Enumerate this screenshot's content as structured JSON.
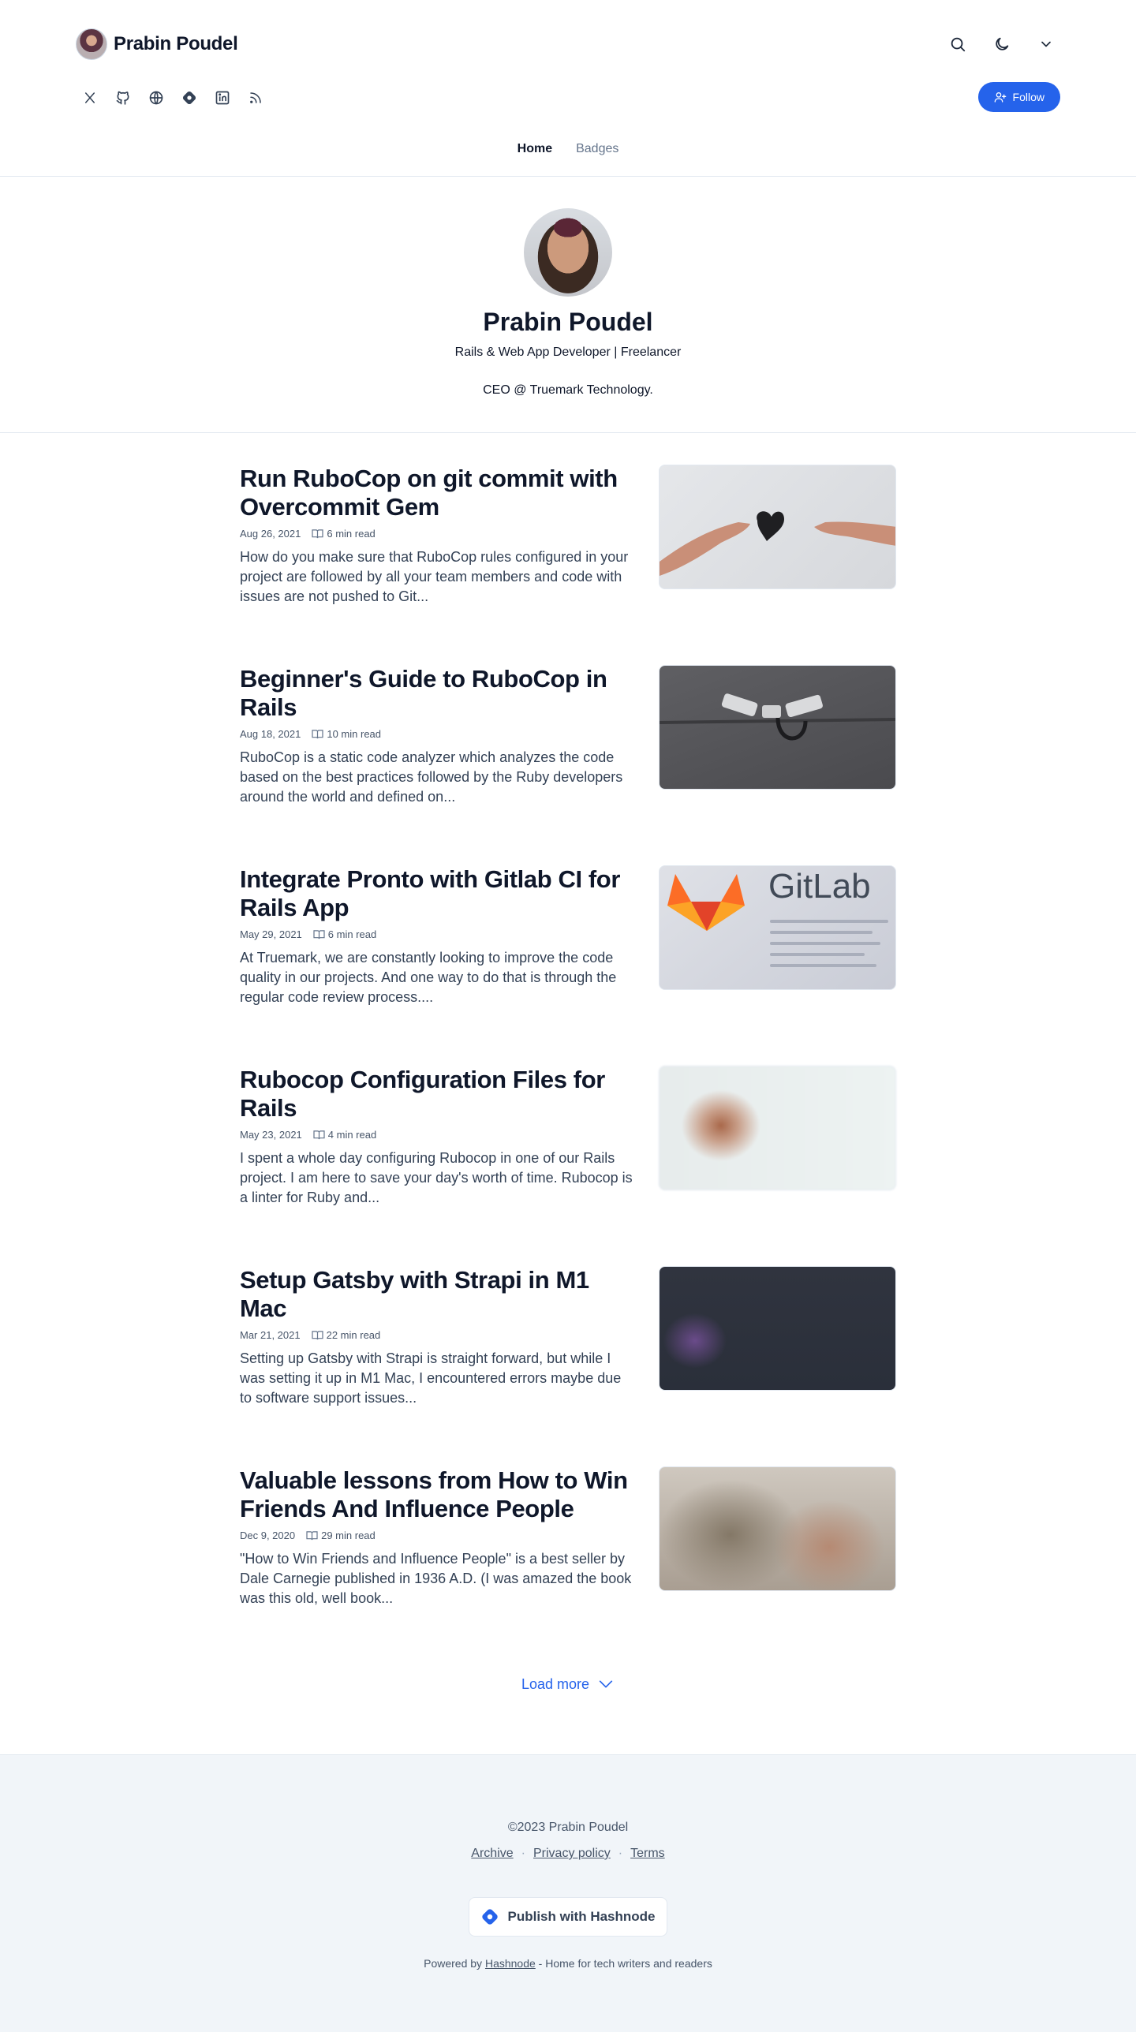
{
  "header": {
    "author_name": "Prabin Poudel",
    "follow_label": "Follow",
    "nav": [
      {
        "label": "Home"
      },
      {
        "label": "Badges"
      }
    ]
  },
  "profile": {
    "name": "Prabin Poudel",
    "tagline": "Rails & Web App Developer | Freelancer",
    "bio": "CEO @ Truemark Technology."
  },
  "posts": [
    {
      "title": "Run RuboCop on git commit with Overcommit Gem",
      "date": "Aug 26, 2021",
      "read_time": "6 min read",
      "excerpt": "How do you make sure that RuboCop rules configured in your project are followed by all your team members and code with issues are not pushed to Git..."
    },
    {
      "title": "Beginner's Guide to RuboCop in Rails",
      "date": "Aug 18, 2021",
      "read_time": "10 min read",
      "excerpt": "RuboCop is a static code analyzer which analyzes the code based on the best practices followed by the Ruby developers around the world and defined on..."
    },
    {
      "title": "Integrate Pronto with Gitlab CI for Rails App",
      "date": "May 29, 2021",
      "read_time": "6 min read",
      "excerpt": "At Truemark, we are constantly looking to improve the code quality in our projects. And one way to do that is through the regular code review process...."
    },
    {
      "title": "Rubocop Configuration Files for Rails",
      "date": "May 23, 2021",
      "read_time": "4 min read",
      "excerpt": "I spent a whole day configuring Rubocop in one of our Rails project. I am here to save your day's worth of time. Rubocop is a linter for Ruby and..."
    },
    {
      "title": "Setup Gatsby with Strapi in M1 Mac",
      "date": "Mar 21, 2021",
      "read_time": "22 min read",
      "excerpt": "Setting up Gatsby with Strapi is straight forward, but while I was setting it up in M1 Mac, I encountered errors maybe due to software support issues..."
    },
    {
      "title": "Valuable lessons from How to Win Friends And Influence People",
      "date": "Dec 9, 2020",
      "read_time": "29 min read",
      "excerpt": "\"How to Win Friends and Influence People\" is a best seller by Dale Carnegie published in 1936 A.D. (I was amazed the book was this old, well book..."
    }
  ],
  "thumb_text": {
    "gitlab": "GitLab"
  },
  "load_more": "Load more",
  "footer": {
    "copyright": "©2023 Prabin Poudel",
    "links": [
      {
        "label": "Archive"
      },
      {
        "label": "Privacy policy"
      },
      {
        "label": "Terms"
      }
    ],
    "separator": "·",
    "publish_label": "Publish with Hashnode",
    "powered_prefix": "Powered by",
    "powered_link": "Hashnode",
    "powered_suffix": "- Home for tech writers and readers"
  },
  "colors": {
    "accent": "#2563eb",
    "text": "#0f172a",
    "muted": "#475569",
    "footer_bg": "#f1f5f9"
  },
  "icons": [
    "search-icon",
    "moon-icon",
    "chevron-down-icon",
    "x-twitter-icon",
    "github-icon",
    "globe-icon",
    "hashnode-icon",
    "linkedin-icon",
    "rss-icon",
    "user-plus-icon",
    "book-icon"
  ]
}
